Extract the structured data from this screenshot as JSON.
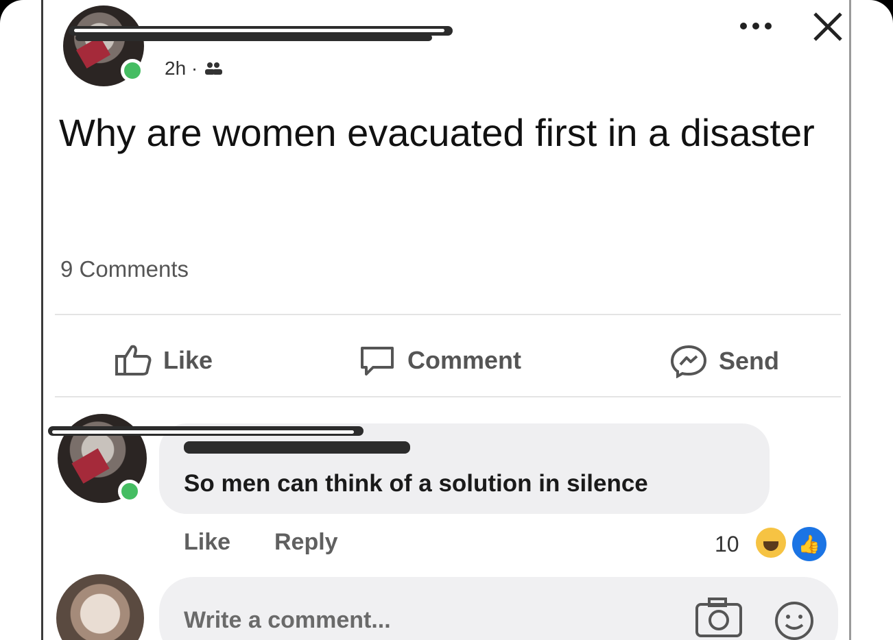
{
  "post": {
    "time_meta": "2h ·",
    "audience_icon": "friends-icon",
    "text": "Why are women evacuated first in a disaster",
    "comments_count": "9 Comments",
    "menu_icon": "ellipsis-icon",
    "close_icon": "close-icon"
  },
  "actions": {
    "like_label": "Like",
    "comment_label": "Comment",
    "send_label": "Send"
  },
  "comment": {
    "text": "So men can think of a solution in silence",
    "like_label": "Like",
    "reply_label": "Reply",
    "reaction_count": "10",
    "reactions": [
      "haha-reaction-icon",
      "like-reaction-icon"
    ]
  },
  "composer": {
    "placeholder": "Write a comment...",
    "camera_icon": "camera-icon",
    "emoji_icon": "emoji-icon"
  },
  "colors": {
    "online": "#45bd62",
    "like_blue": "#1b74e4",
    "haha_yellow": "#f6c343"
  }
}
